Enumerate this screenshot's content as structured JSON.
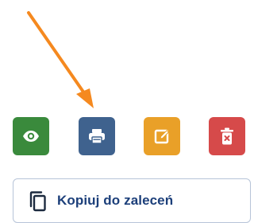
{
  "colors": {
    "view": "#3a8a3c",
    "print": "#3f628e",
    "edit": "#e9a028",
    "delete": "#d64a4a",
    "arrow": "#f5891f"
  },
  "toolbar": {
    "buttons": [
      {
        "name": "view-button",
        "icon": "eye-icon"
      },
      {
        "name": "print-button",
        "icon": "printer-icon"
      },
      {
        "name": "edit-button",
        "icon": "edit-icon"
      },
      {
        "name": "delete-button",
        "icon": "trash-icon"
      }
    ]
  },
  "copy_button": {
    "label": "Kopiuj do zaleceń",
    "icon": "copy-icon"
  },
  "annotation": {
    "icon": "arrow-pointer-icon",
    "points_to": "print-button"
  }
}
